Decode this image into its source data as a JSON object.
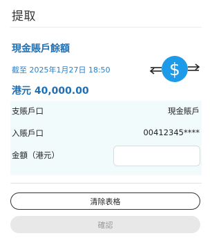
{
  "page": {
    "title": "提取"
  },
  "balance": {
    "label": "現金賬戶餘額",
    "as_of": "截至 2025年1月27日 18:50",
    "amount": "港元 40,000.00"
  },
  "form": {
    "from_account_label": "支賬戶口",
    "from_account_value": "現金賬戶",
    "to_account_label": "入賬戶口",
    "to_account_value": "00412345****",
    "amount_label": "金額（港元）",
    "amount_value": "",
    "amount_placeholder": ""
  },
  "buttons": {
    "clear_label": "清除表格",
    "confirm_label": "確認",
    "confirm_enabled": false
  },
  "icons": {
    "transfer": "dollar-transfer-icon"
  },
  "colors": {
    "accent_blue": "#1f6fb2",
    "icon_circle": "#1e9be8",
    "form_background": "#f1fbfc",
    "disabled_button": "#e8e8e8"
  }
}
